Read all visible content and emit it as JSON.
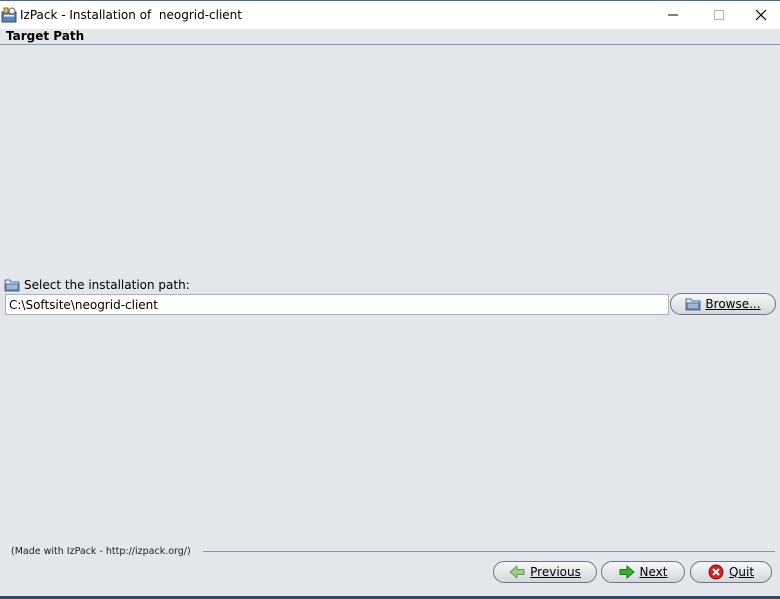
{
  "window": {
    "title": "IzPack - Installation of  neogrid-client",
    "icon": "izpack-app-icon",
    "controls": [
      "minimize-icon",
      "maximize-icon",
      "close-icon"
    ]
  },
  "panel": {
    "title": "Target Path"
  },
  "target": {
    "label": "Select the installation path:",
    "path_value": "C:\\Softsite\\neogrid-client",
    "browse_label": "Browse..."
  },
  "footer": {
    "made_with": "(Made with IzPack - http://izpack.org/)"
  },
  "nav": {
    "previous_label": "Previous",
    "next_label": "Next",
    "quit_label": "Quit"
  },
  "colors": {
    "background": "#e3e7ec",
    "next_arrow": "#3cae2c",
    "quit_icon": "#d02020"
  }
}
